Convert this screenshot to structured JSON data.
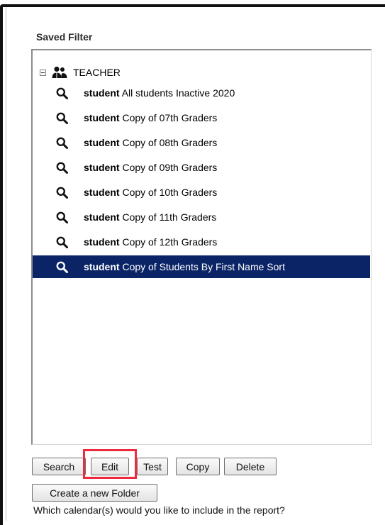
{
  "section": {
    "title": "Saved Filter"
  },
  "tree": {
    "root": {
      "label": "TEACHER",
      "toggle_icon": "collapse-minus-icon",
      "group_icon": "users-group-icon"
    },
    "items": [
      {
        "type": "student",
        "name": "All students Inactive 2020",
        "selected": false
      },
      {
        "type": "student",
        "name": "Copy of 07th Graders",
        "selected": false
      },
      {
        "type": "student",
        "name": "Copy of 08th Graders",
        "selected": false
      },
      {
        "type": "student",
        "name": "Copy of 09th Graders",
        "selected": false
      },
      {
        "type": "student",
        "name": "Copy of 10th Graders",
        "selected": false
      },
      {
        "type": "student",
        "name": "Copy of 11th Graders",
        "selected": false
      },
      {
        "type": "student",
        "name": "Copy of 12th Graders",
        "selected": false
      },
      {
        "type": "student",
        "name": "Copy of Students By First Name Sort",
        "selected": true
      }
    ],
    "item_icon": "magnifier-icon"
  },
  "buttons": {
    "search": "Search",
    "edit": "Edit",
    "test": "Test",
    "copy": "Copy",
    "delete": "Delete",
    "create_folder": "Create a new Folder"
  },
  "question": "Which calendar(s) would you like to include in the report?",
  "colors": {
    "selected_bg": "#0a2466",
    "highlight": "#ee2a3f"
  }
}
